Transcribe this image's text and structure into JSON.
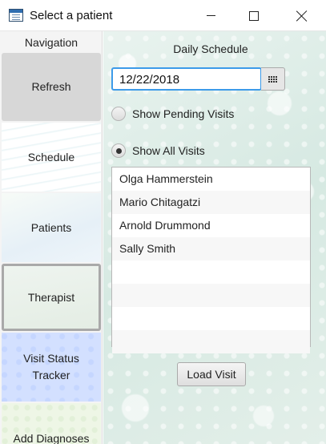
{
  "window": {
    "title": "Select a patient"
  },
  "sidebar": {
    "heading": "Navigation",
    "items": [
      {
        "label": "Refresh"
      },
      {
        "label": "Schedule"
      },
      {
        "label": "Patients"
      },
      {
        "label": "Therapist"
      },
      {
        "label": "Visit Status Tracker"
      },
      {
        "label": "Add Diagnoses"
      }
    ]
  },
  "main": {
    "heading": "Daily Schedule",
    "date_value": "12/22/2018",
    "radio_pending": {
      "label": "Show Pending Visits",
      "checked": false
    },
    "radio_all": {
      "label": "Show All Visits",
      "checked": true
    },
    "visits": [
      "Olga Hammerstein",
      "Mario Chitagatzi",
      "Arnold Drummond",
      "Sally Smith",
      "",
      "",
      "",
      ""
    ],
    "load_button": "Load Visit"
  }
}
